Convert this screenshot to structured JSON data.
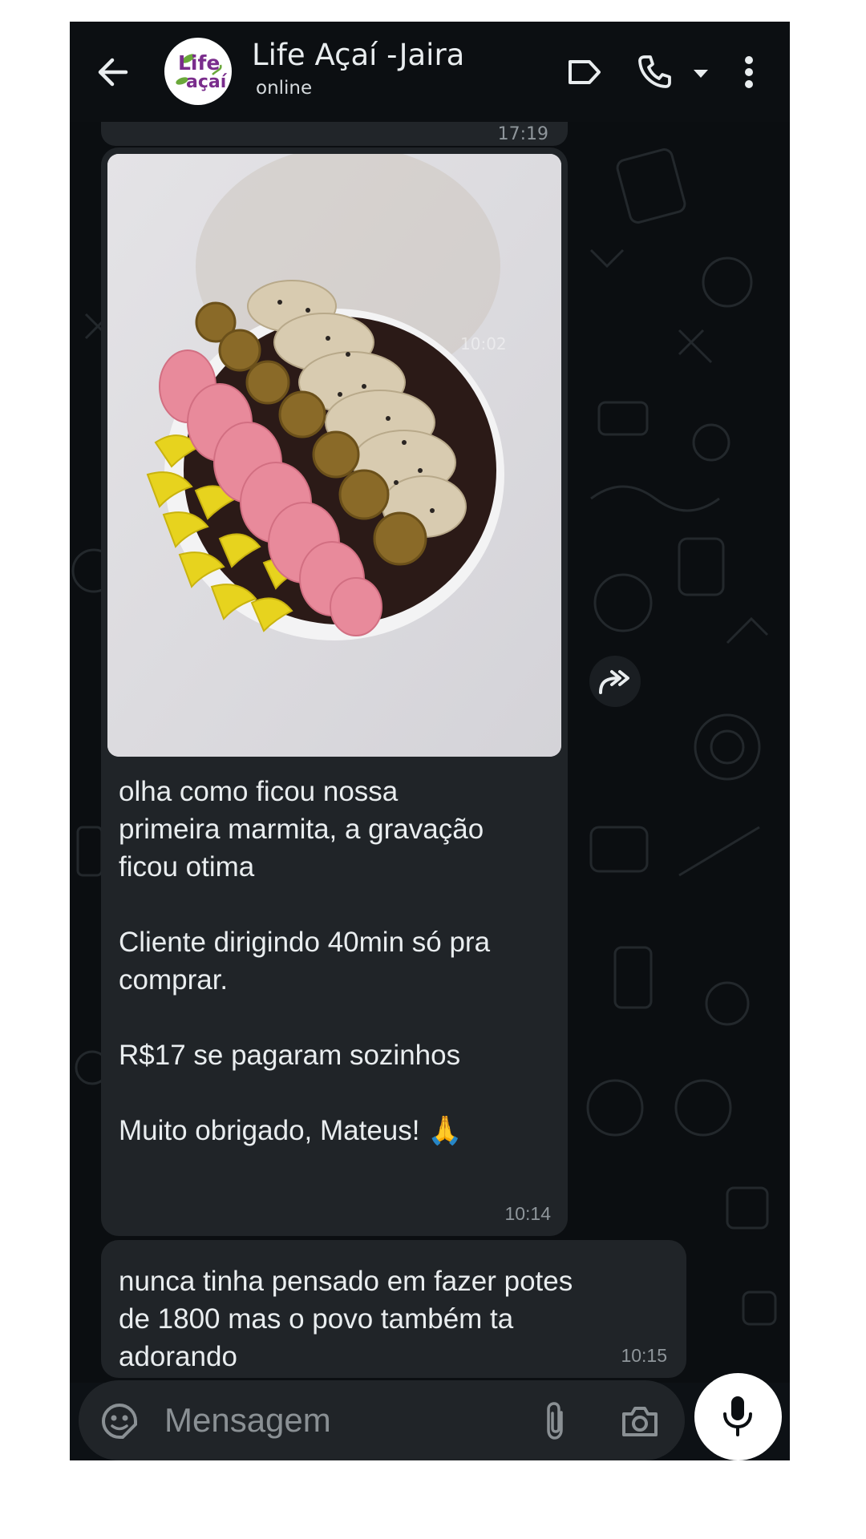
{
  "header": {
    "back_icon": "arrow-left-icon",
    "avatar_logo_line1": "Life",
    "avatar_logo_line2": "açaí",
    "contact_name": "Life Açaí -Jaira",
    "status": "online",
    "actions": [
      "label-icon",
      "phone-icon",
      "dropdown-icon",
      "more-vertical-icon"
    ]
  },
  "chat": {
    "previous_message_time": "17:19",
    "messages": [
      {
        "type": "image",
        "image_overlay_time": "10:02",
        "text": "olha como ficou nossa\nprimeira marmita, a gravação\nficou otima\n\nCliente dirigindo 40min só pra\ncomprar.\n\nR$17 se pagaram sozinhos\n\nMuito obrigado, Mateus! 🙏",
        "time": "10:14"
      },
      {
        "type": "text",
        "text": "nunca tinha pensado em fazer potes\nde 1800 mas o povo também ta\nadorando",
        "time": "10:15"
      }
    ],
    "forward_icon": "forward-icon"
  },
  "composer": {
    "placeholder": "Mensagem",
    "emoji_icon": "sticker-icon",
    "attach_icon": "paperclip-icon",
    "camera_icon": "camera-icon",
    "mic_icon": "mic-icon"
  },
  "colors": {
    "header_bg": "#0c0f12",
    "chat_bg": "#0b0e11",
    "bubble_bg": "#202428",
    "text": "#e9edef",
    "timestamp": "#8f969b",
    "logo_purple": "#7a2d8c",
    "logo_green": "#6aa83a"
  }
}
